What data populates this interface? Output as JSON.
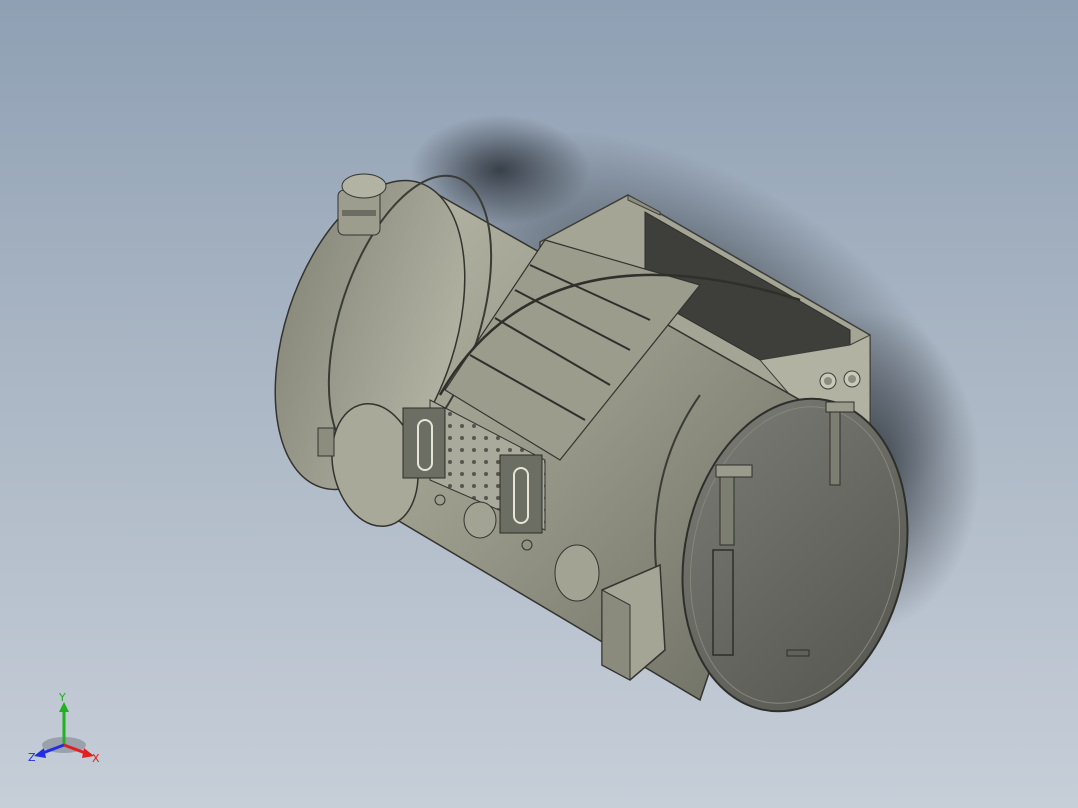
{
  "viewport": {
    "background_top": "#8fa0b4",
    "background_bottom": "#c6ced8"
  },
  "model": {
    "body_color": "#8e8f80",
    "end_cap_color": "#6f706a",
    "frame_color": "#9fa08f",
    "shadow_color": "#2a3038"
  },
  "triad": {
    "x_label": "X",
    "y_label": "Y",
    "z_label": "Z",
    "x_color": "#e02020",
    "y_color": "#20b020",
    "z_color": "#2030e0"
  }
}
